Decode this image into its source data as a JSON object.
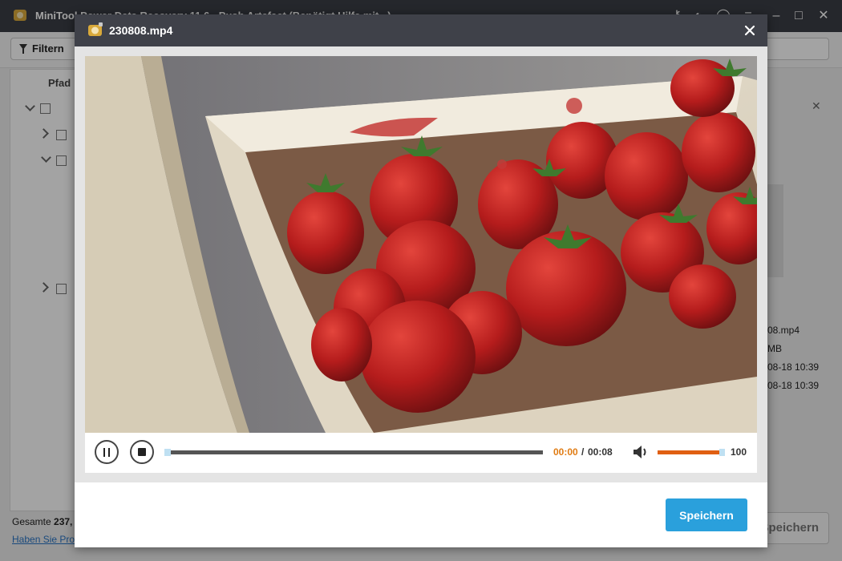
{
  "app": {
    "title": "MiniTool Power Data Recovery 11.6 - Push Artefact (Benötigt Hilfe mit...)",
    "filter_label": "Filtern",
    "path_header": "Pfad",
    "info_lines": [
      "08.mp4",
      "MB",
      "08-18 10:39",
      "08-18 10:39"
    ],
    "footer_total_prefix": "Gesamte",
    "footer_total_value": "237,",
    "footer_link": "Haben Sie Pro",
    "save_label": "Speichern"
  },
  "dialog": {
    "title": "230808.mp4",
    "close_icon": "close-icon",
    "player": {
      "time_current": "00:00",
      "time_separator": "/",
      "time_total": "00:08",
      "progress": 0,
      "volume": 100,
      "volume_label": "100"
    },
    "save_label": "Speichern"
  },
  "colors": {
    "titlebar": "#3a3d45",
    "dialog_header": "#3f4149",
    "save_button": "#2aa0dc",
    "time_current": "#e07b12",
    "volume_fill": "#e05f12",
    "seek_bar": "#555555"
  }
}
